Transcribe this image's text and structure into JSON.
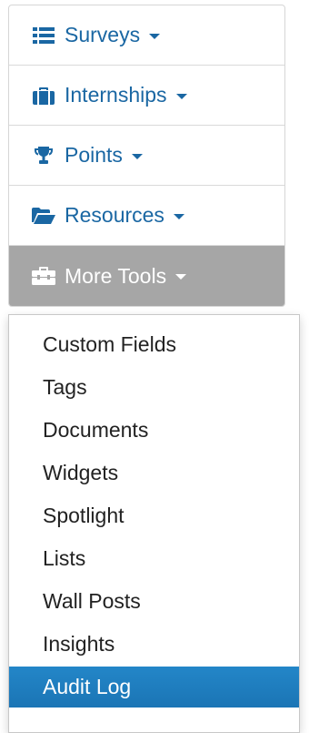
{
  "nav": {
    "items": [
      {
        "label": "Surveys",
        "icon": "list-icon"
      },
      {
        "label": "Internships",
        "icon": "briefcase-icon"
      },
      {
        "label": "Points",
        "icon": "trophy-icon"
      },
      {
        "label": "Resources",
        "icon": "folder-open-icon"
      },
      {
        "label": "More Tools",
        "icon": "toolbox-icon",
        "active": true
      }
    ]
  },
  "dropdown": {
    "items": [
      {
        "label": "Custom Fields"
      },
      {
        "label": "Tags"
      },
      {
        "label": "Documents"
      },
      {
        "label": "Widgets"
      },
      {
        "label": "Spotlight"
      },
      {
        "label": "Lists"
      },
      {
        "label": "Wall Posts"
      },
      {
        "label": "Insights"
      },
      {
        "label": "Audit Log",
        "selected": true
      }
    ]
  },
  "colors": {
    "link": "#1a67a3",
    "active_bg": "#a6a6a6",
    "selected_bg": "#1b75b5"
  }
}
